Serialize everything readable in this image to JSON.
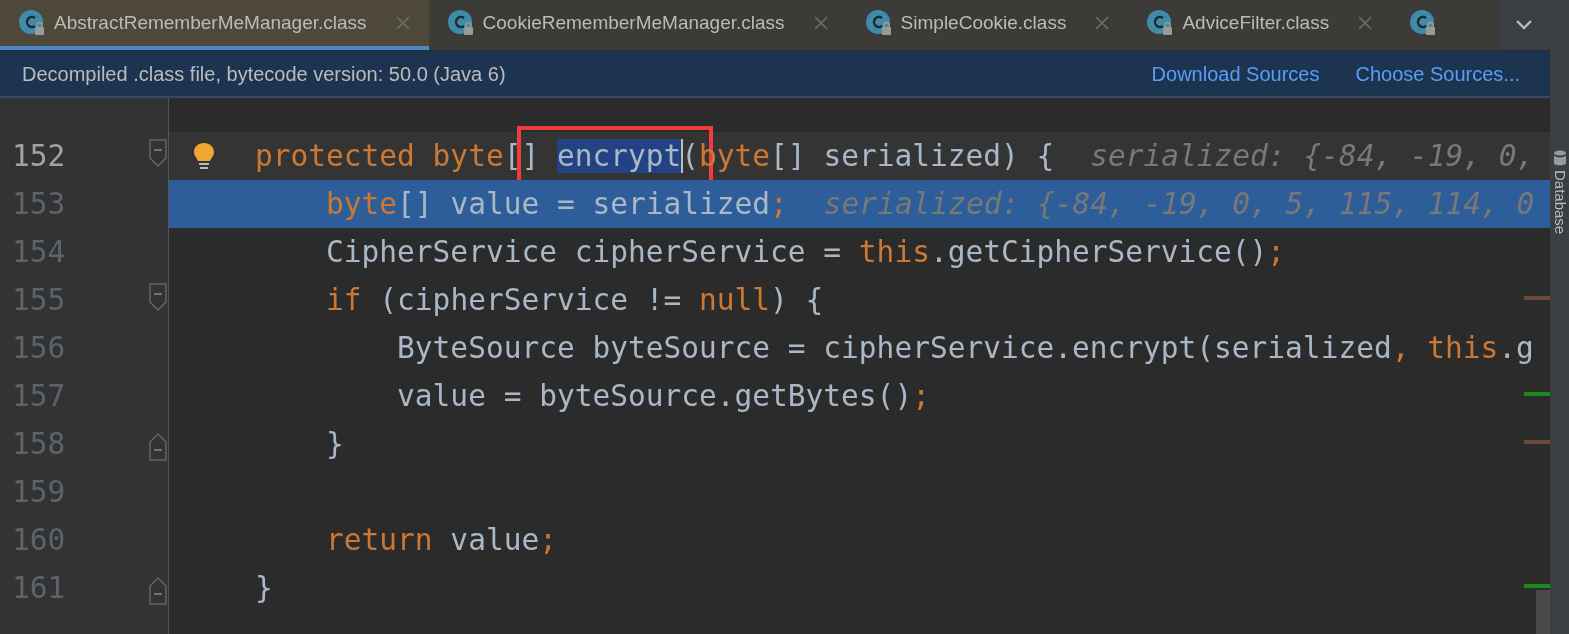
{
  "tabs": [
    {
      "label": "AbstractRememberMeManager.class",
      "selected": true
    },
    {
      "label": "CookieRememberMeManager.class",
      "selected": false
    },
    {
      "label": "SimpleCookie.class",
      "selected": false
    },
    {
      "label": "AdviceFilter.class",
      "selected": false
    },
    {
      "selected": false
    }
  ],
  "banner": {
    "message": "Decompiled .class file, bytecode version: 50.0 (Java 6)",
    "links": [
      "Download Sources",
      "Choose Sources..."
    ]
  },
  "lines": [
    {
      "selected": false
    },
    {
      "number": "152",
      "current": true,
      "selected": false,
      "fold": {
        "kind": "start"
      },
      "bulb": true,
      "tokens": [
        {
          "text": "protected byte",
          "kind": "keyword"
        },
        {
          "text": "[",
          "kind": "plain"
        },
        {
          "text": "] ",
          "kind": "plain",
          "boxed": true
        },
        {
          "text": "encrypt",
          "kind": "selection",
          "boxed": true,
          "caret": true
        },
        {
          "text": "(",
          "kind": "plain",
          "boxed": true
        },
        {
          "text": "byte",
          "kind": "keyword"
        },
        {
          "text": "[] serialized) {",
          "kind": "plain"
        }
      ],
      "hint": "serialized: {-84, -19, 0,"
    },
    {
      "number": "153",
      "selected": true,
      "tokens": [
        {
          "text": "    byte",
          "kind": "keyword"
        },
        {
          "text": "[] value = serialized",
          "kind": "plain"
        },
        {
          "text": ";",
          "kind": "keyword"
        }
      ],
      "hint": "serialized: {-84, -19, 0, 5, 115, 114, 0"
    },
    {
      "number": "154",
      "selected": false,
      "tokens": [
        {
          "text": "    CipherService cipherService = ",
          "kind": "plain"
        },
        {
          "text": "this",
          "kind": "keyword"
        },
        {
          "text": ".getCipherService()",
          "kind": "plain"
        },
        {
          "text": ";",
          "kind": "keyword"
        }
      ]
    },
    {
      "number": "155",
      "selected": false,
      "fold": {
        "kind": "start"
      },
      "marker": {
        "color": "#6b4a3c"
      },
      "tokens": [
        {
          "text": "    if",
          "kind": "keyword"
        },
        {
          "text": " (cipherService != ",
          "kind": "plain"
        },
        {
          "text": "null",
          "kind": "keyword"
        },
        {
          "text": ") {",
          "kind": "plain"
        }
      ]
    },
    {
      "number": "156",
      "selected": false,
      "tokens": [
        {
          "text": "        ByteSource byteSource = cipherService.encrypt(serialized",
          "kind": "plain"
        },
        {
          "text": ", this",
          "kind": "keyword"
        },
        {
          "text": ".g",
          "kind": "plain"
        }
      ]
    },
    {
      "number": "157",
      "selected": false,
      "marker": {
        "color": "#1a8a1a"
      },
      "tokens": [
        {
          "text": "        value = byteSource.getBytes()",
          "kind": "plain"
        },
        {
          "text": ";",
          "kind": "keyword"
        }
      ]
    },
    {
      "number": "158",
      "selected": false,
      "fold": {
        "kind": "end"
      },
      "marker": {
        "color": "#6b4a3c"
      },
      "tokens": [
        {
          "text": "    }",
          "kind": "plain"
        }
      ]
    },
    {
      "number": "159",
      "selected": false
    },
    {
      "number": "160",
      "selected": false,
      "tokens": [
        {
          "text": "    return",
          "kind": "keyword"
        },
        {
          "text": " value",
          "kind": "plain"
        },
        {
          "text": ";",
          "kind": "keyword"
        }
      ]
    },
    {
      "number": "161",
      "selected": false,
      "fold": {
        "kind": "end"
      },
      "marker": {
        "color": "#1a8a1a"
      },
      "tokens": [
        {
          "text": "}",
          "kind": "plain"
        }
      ]
    },
    {
      "selected": false
    }
  ],
  "side_strip": {
    "items": [
      "Database"
    ]
  }
}
